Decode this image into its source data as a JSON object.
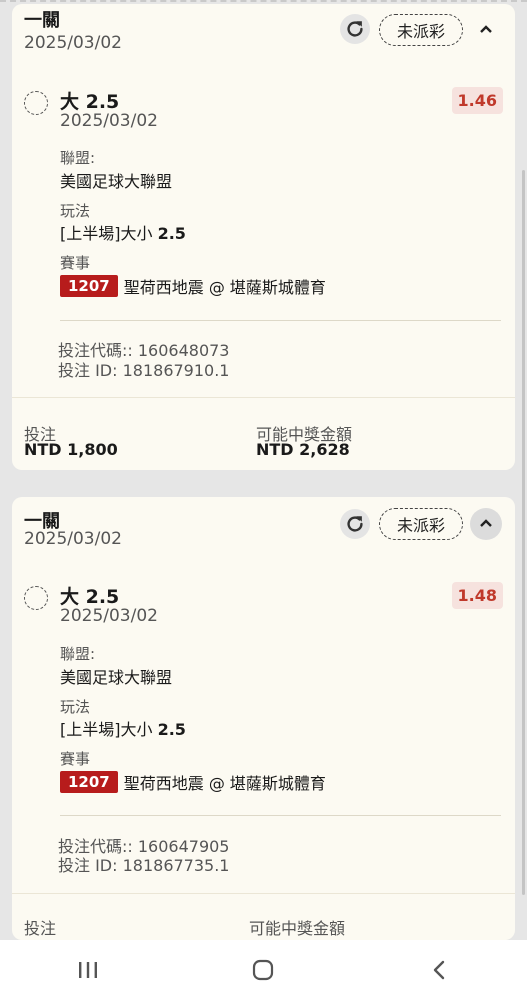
{
  "cards": [
    {
      "title": "一關",
      "date": "2025/03/02",
      "status": "未派彩",
      "selection": {
        "name": "大 2.5",
        "date": "2025/03/02",
        "odds": "1.46",
        "league_label": "聯盟:",
        "league": "美國足球大聯盟",
        "market_label": "玩法",
        "market_prefix": "[上半場]大小",
        "market_line": "2.5",
        "event_label": "賽事",
        "match_id": "1207",
        "match": "聖荷西地震 @ 堪薩斯城體育",
        "bet_code": "投注代碼:: 160648073",
        "bet_id": "投注 ID: 181867910.1"
      },
      "stake_label": "投注",
      "stake": "NTD 1,800",
      "payout_label": "可能中獎金額",
      "payout": "NTD 2,628"
    },
    {
      "title": "一關",
      "date": "2025/03/02",
      "status": "未派彩",
      "selection": {
        "name": "大 2.5",
        "date": "2025/03/02",
        "odds": "1.48",
        "league_label": "聯盟:",
        "league": "美國足球大聯盟",
        "market_label": "玩法",
        "market_prefix": "[上半場]大小",
        "market_line": "2.5",
        "event_label": "賽事",
        "match_id": "1207",
        "match": "聖荷西地震 @ 堪薩斯城體育",
        "bet_code": "投注代碼:: 160647905",
        "bet_id": "投注 ID: 181867735.1"
      },
      "stake_label": "投注",
      "payout_label": "可能中獎金額"
    }
  ],
  "icons": {
    "refresh": "refresh-icon",
    "collapse": "chevron-up-icon",
    "nav_recent": "recent-apps-icon",
    "nav_home": "home-icon",
    "nav_back": "back-icon"
  },
  "colors": {
    "card_bg": "#fcfaf2",
    "page_bg": "#e6e6e6",
    "odds_text": "#c0392b",
    "odds_bg": "#f6e2de",
    "match_id_bg": "#b71c1c"
  }
}
